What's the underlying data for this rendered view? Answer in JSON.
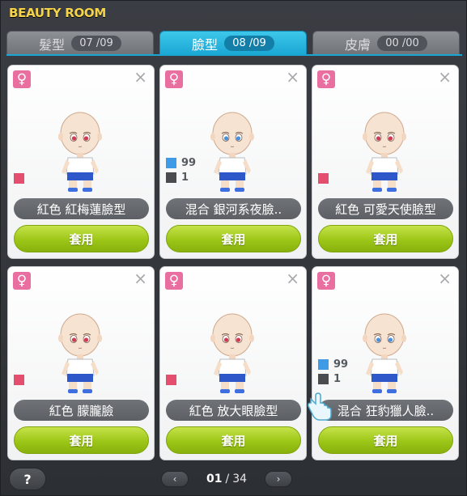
{
  "title": "BEAUTY ROOM",
  "tabs": [
    {
      "label": "髮型",
      "count": "07 /09",
      "active": false
    },
    {
      "label": "臉型",
      "count": "08 /09",
      "active": true
    },
    {
      "label": "皮膚",
      "count": "00 /00",
      "active": false
    }
  ],
  "cards": [
    {
      "name": "紅色  紅梅蓮臉型",
      "apply": "套用",
      "mix": null,
      "swatch": "#e44f6f",
      "eye": "#d23a4f"
    },
    {
      "name": "混合  銀河系夜臉..",
      "apply": "套用",
      "mix": {
        "a_value": "99",
        "b_value": "1",
        "a_color": "#3f9be6",
        "b_color": "#4a4c50"
      },
      "swatch": null,
      "eye": "#4b90d9"
    },
    {
      "name": "紅色  可愛天使臉型",
      "apply": "套用",
      "mix": null,
      "swatch": "#e44f6f",
      "eye": "#d23a4f"
    },
    {
      "name": "紅色  朦朧臉",
      "apply": "套用",
      "mix": null,
      "swatch": "#e44f6f",
      "eye": "#d23a4f"
    },
    {
      "name": "紅色  放大眼臉型",
      "apply": "套用",
      "mix": null,
      "swatch": "#e44f6f",
      "eye": "#d23a4f"
    },
    {
      "name": "混合  狂豹獵人臉..",
      "apply": "套用",
      "mix": {
        "a_value": "99",
        "b_value": "1",
        "a_color": "#3f9be6",
        "b_color": "#4a4c50"
      },
      "swatch": null,
      "eye": "#4b90d9"
    }
  ],
  "gender_symbol": "♀",
  "close_symbol": "×",
  "help_label": "?",
  "pager": {
    "current": "01",
    "separator": "/",
    "total": "34",
    "prev": "‹",
    "next": "›"
  },
  "colors": {
    "accent": "#1aa6d3",
    "apply_green": "#9cc617",
    "gender_pink": "#ea6fa1",
    "title_yellow": "#f6d44a"
  }
}
